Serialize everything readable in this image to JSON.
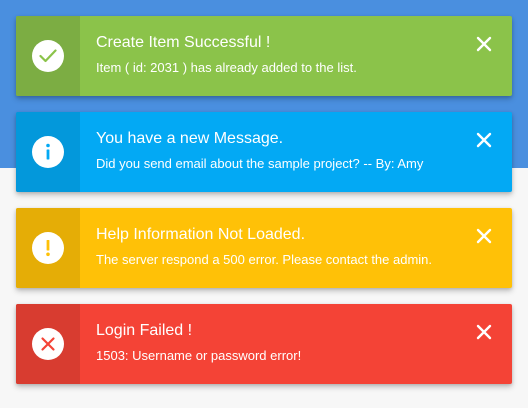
{
  "alerts": [
    {
      "type": "success",
      "icon": "check-icon",
      "title": "Create Item Successful !",
      "message": "Item ( id: 2031 ) has already added to the list.",
      "color": "#8bc34a",
      "icon_bg": "#7cad43"
    },
    {
      "type": "info",
      "icon": "info-icon",
      "title": "You have a new Message.",
      "message": "Did you send email about the sample project? -- By: Amy",
      "color": "#03a9f4",
      "icon_bg": "#0398db"
    },
    {
      "type": "warning",
      "icon": "exclamation-icon",
      "title": "Help Information Not Loaded.",
      "message": "The server respond a 500 error. Please contact the admin.",
      "color": "#ffc107",
      "icon_bg": "#e5ad06"
    },
    {
      "type": "error",
      "icon": "cross-icon",
      "title": "Login Failed !",
      "message": "1503: Username or password error!",
      "color": "#f44336",
      "icon_bg": "#d83c30"
    }
  ],
  "close_icon": "close-icon",
  "background": {
    "top": "#4a8fdf",
    "bottom": "#f7f7f7"
  }
}
